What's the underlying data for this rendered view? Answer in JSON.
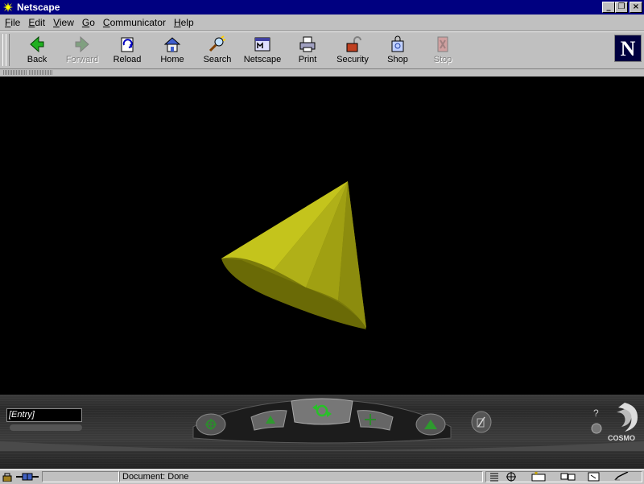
{
  "window": {
    "title": "Netscape"
  },
  "menu": [
    {
      "label": "File",
      "key": "F",
      "rest": "ile"
    },
    {
      "label": "Edit",
      "key": "E",
      "rest": "dit"
    },
    {
      "label": "View",
      "key": "V",
      "rest": "iew"
    },
    {
      "label": "Go",
      "key": "G",
      "rest": "o"
    },
    {
      "label": "Communicator",
      "key": "C",
      "rest": "ommunicator"
    },
    {
      "label": "Help",
      "key": "H",
      "rest": "elp"
    }
  ],
  "toolbar": {
    "back": "Back",
    "forward": "Forward",
    "reload": "Reload",
    "home": "Home",
    "search": "Search",
    "netscape": "Netscape",
    "print": "Print",
    "security": "Security",
    "shop": "Shop",
    "stop": "Stop"
  },
  "logo": {
    "letter": "N"
  },
  "dashboard": {
    "entry_value": "[Entry]",
    "brand": "COSMO",
    "help_glyph": "?"
  },
  "status": {
    "text": "Document: Done"
  },
  "colors": {
    "titlebar": "#000080",
    "chrome": "#c0c0c0",
    "cone": "#a8a800"
  }
}
